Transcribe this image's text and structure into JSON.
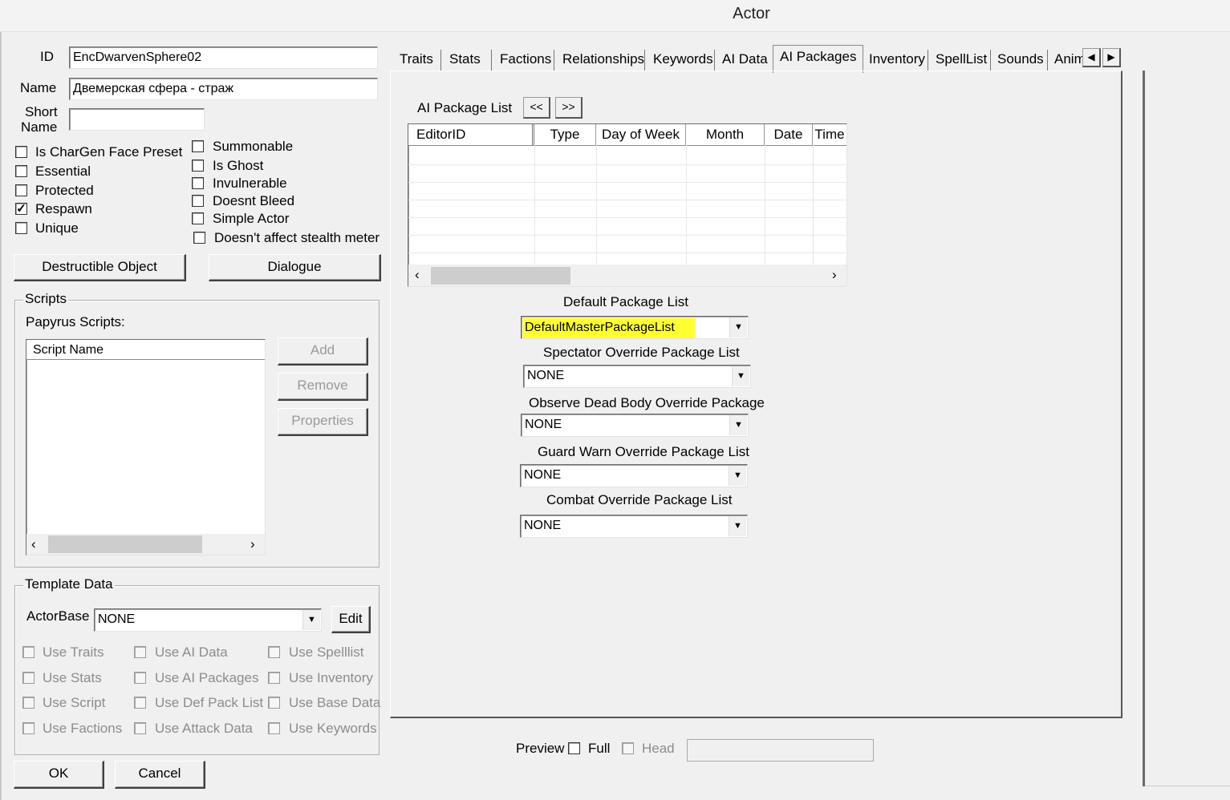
{
  "window": {
    "title": "Actor"
  },
  "left": {
    "id_label": "ID",
    "id_value": "EncDwarvenSphere02",
    "name_label": "Name",
    "name_value": "Двемерская сфера - страж",
    "short_name_label1": "Short",
    "short_name_label2": "Name",
    "short_name_value": "",
    "flags_left": [
      {
        "label": "Is CharGen Face Preset",
        "checked": false
      },
      {
        "label": "Essential",
        "checked": false
      },
      {
        "label": "Protected",
        "checked": false
      },
      {
        "label": "Respawn",
        "checked": true
      },
      {
        "label": "Unique",
        "checked": false
      }
    ],
    "flags_right": [
      {
        "label": "Summonable",
        "checked": false
      },
      {
        "label": "Is Ghost",
        "checked": false
      },
      {
        "label": "Invulnerable",
        "checked": false
      },
      {
        "label": "Doesnt Bleed",
        "checked": false
      },
      {
        "label": "Simple Actor",
        "checked": false
      },
      {
        "label": "Doesn't affect stealth meter",
        "checked": false
      }
    ],
    "destructible_button": "Destructible Object",
    "dialogue_button": "Dialogue"
  },
  "scripts": {
    "group_title": "Scripts",
    "papyrus_label": "Papyrus Scripts:",
    "column_header": "Script Name",
    "add_button": "Add",
    "remove_button": "Remove",
    "properties_button": "Properties"
  },
  "template": {
    "group_title": "Template Data",
    "actorbase_label": "ActorBase",
    "actorbase_value": "NONE",
    "edit_button": "Edit",
    "options": [
      [
        "Use Traits",
        "Use AI Data",
        "Use Spelllist"
      ],
      [
        "Use Stats",
        "Use AI Packages",
        "Use Inventory"
      ],
      [
        "Use Script",
        "Use Def Pack List",
        "Use Base Data"
      ],
      [
        "Use Factions",
        "Use Attack Data",
        "Use Keywords"
      ]
    ]
  },
  "footer": {
    "ok_button": "OK",
    "cancel_button": "Cancel",
    "preview_label": "Preview",
    "full_label": "Full",
    "head_label": "Head"
  },
  "tabs": [
    "Traits",
    "Stats",
    "Factions",
    "Relationships",
    "Keywords",
    "AI Data",
    "AI Packages",
    "Inventory",
    "SpellList",
    "Sounds",
    "Anim"
  ],
  "active_tab": "AI Packages",
  "ai_packages": {
    "list_label": "AI Package List",
    "prev_button": "<<",
    "next_button": ">>",
    "columns": [
      "EditorID",
      "Type",
      "Day of Week",
      "Month",
      "Date",
      "Time"
    ],
    "default_list_label": "Default Package List",
    "default_list_value": "DefaultMasterPackageList",
    "spectator_label": "Spectator Override Package List",
    "spectator_value": "NONE",
    "observe_label": "Observe Dead Body Override Package",
    "observe_value": "NONE",
    "guard_label": "Guard Warn Override Package List",
    "guard_value": "NONE",
    "combat_label": "Combat Override Package List",
    "combat_value": "NONE"
  },
  "colors": {
    "highlight": "#ffff33"
  }
}
